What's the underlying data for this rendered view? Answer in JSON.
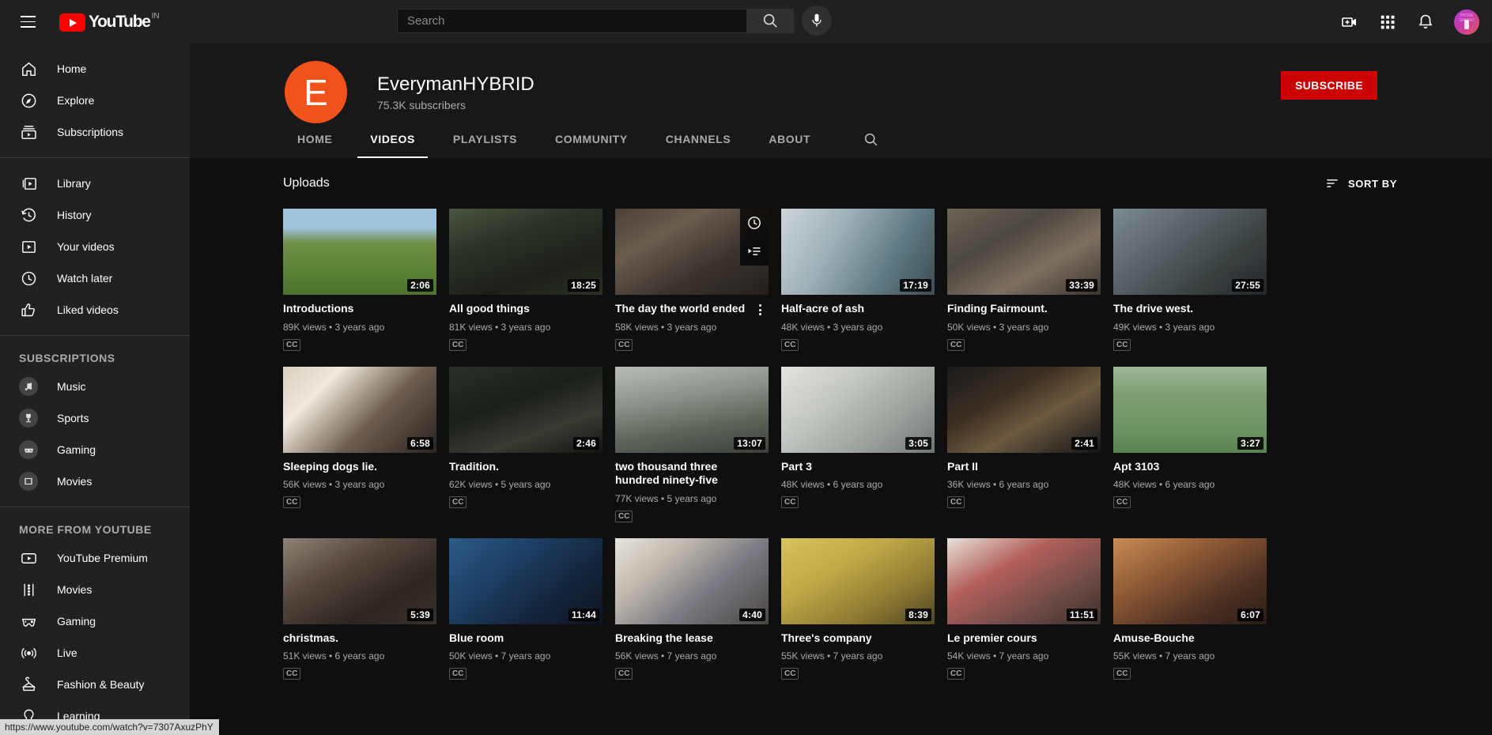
{
  "topbar": {
    "logo_text": "YouTube",
    "logo_country": "IN",
    "search_placeholder": "Search",
    "search_value": "",
    "icons": {
      "menu": "hamburger-icon",
      "search": "search-icon",
      "mic": "microphone-icon",
      "create": "create-video-icon",
      "apps": "youtube-apps-icon",
      "notifications": "notifications-bell-icon",
      "avatar": "account-avatar"
    }
  },
  "sidebar": {
    "primary": [
      {
        "label": "Home",
        "icon": "home-icon"
      },
      {
        "label": "Explore",
        "icon": "compass-icon"
      },
      {
        "label": "Subscriptions",
        "icon": "subscriptions-icon"
      }
    ],
    "library": [
      {
        "label": "Library",
        "icon": "library-icon"
      },
      {
        "label": "History",
        "icon": "history-icon"
      },
      {
        "label": "Your videos",
        "icon": "your-videos-icon"
      },
      {
        "label": "Watch later",
        "icon": "clock-icon"
      },
      {
        "label": "Liked videos",
        "icon": "thumbs-up-icon"
      }
    ],
    "subscriptions_title": "SUBSCRIPTIONS",
    "subscriptions": [
      {
        "label": "Music",
        "icon": "music-note-icon"
      },
      {
        "label": "Sports",
        "icon": "trophy-icon"
      },
      {
        "label": "Gaming",
        "icon": "gamepad-icon"
      },
      {
        "label": "Movies",
        "icon": "film-icon"
      }
    ],
    "more_title": "MORE FROM YOUTUBE",
    "more": [
      {
        "label": "YouTube Premium",
        "icon": "youtube-premium-icon"
      },
      {
        "label": "Movies",
        "icon": "film-strip-icon"
      },
      {
        "label": "Gaming",
        "icon": "gamepad-icon"
      },
      {
        "label": "Live",
        "icon": "live-broadcast-icon"
      },
      {
        "label": "Fashion & Beauty",
        "icon": "hanger-icon"
      },
      {
        "label": "Learning",
        "icon": "lightbulb-icon"
      }
    ]
  },
  "channel": {
    "avatar_letter": "E",
    "avatar_color": "#f1511b",
    "name": "EverymanHYBRID",
    "subscribers": "75.3K subscribers",
    "subscribe_label": "SUBSCRIBE",
    "subscribe_color": "#cc0000",
    "tabs": [
      {
        "label": "HOME",
        "active": false
      },
      {
        "label": "VIDEOS",
        "active": true
      },
      {
        "label": "PLAYLISTS",
        "active": false
      },
      {
        "label": "COMMUNITY",
        "active": false
      },
      {
        "label": "CHANNELS",
        "active": false
      },
      {
        "label": "ABOUT",
        "active": false
      }
    ]
  },
  "content": {
    "section_title": "Uploads",
    "sort_label": "SORT BY",
    "cc_badge": "CC",
    "rows": [
      [
        {
          "title": "Introductions",
          "duration": "2:06",
          "views": "89K views",
          "age": "3 years ago",
          "cc": true,
          "hovered": false,
          "thumb": "field-boy-running"
        },
        {
          "title": "All good things",
          "duration": "18:25",
          "views": "81K views",
          "age": "3 years ago",
          "cc": true,
          "hovered": false,
          "thumb": "two-men-outdoors"
        },
        {
          "title": "The day the world ended",
          "duration": "",
          "views": "58K views",
          "age": "3 years ago",
          "cc": true,
          "hovered": true,
          "thumb": "kitchen-fridge-men"
        },
        {
          "title": "Half-acre of ash",
          "duration": "17:19",
          "views": "48K views",
          "age": "3 years ago",
          "cc": true,
          "hovered": false,
          "thumb": "man-with-axe-door"
        },
        {
          "title": "Finding Fairmount.",
          "duration": "33:39",
          "views": "50K views",
          "age": "3 years ago",
          "cc": true,
          "hovered": false,
          "thumb": "burnt-debris"
        },
        {
          "title": "The drive west.",
          "duration": "27:55",
          "views": "49K views",
          "age": "3 years ago",
          "cc": true,
          "hovered": false,
          "thumb": "man-driving-car"
        }
      ],
      [
        {
          "title": "Sleeping dogs lie.",
          "duration": "6:58",
          "views": "56K views",
          "age": "3 years ago",
          "cc": true,
          "hovered": false,
          "thumb": "bedroom-window-light"
        },
        {
          "title": "Tradition.",
          "duration": "2:46",
          "views": "62K views",
          "age": "5 years ago",
          "cc": true,
          "hovered": false,
          "thumb": "man-christmas-tree"
        },
        {
          "title": "two thousand three hundred ninety-five",
          "duration": "13:07",
          "views": "77K views",
          "age": "5 years ago",
          "cc": true,
          "hovered": false,
          "thumb": "slow-down-sign-tree"
        },
        {
          "title": "Part 3",
          "duration": "3:05",
          "views": "48K views",
          "age": "6 years ago",
          "cc": true,
          "hovered": false,
          "thumb": "open-refrigerator"
        },
        {
          "title": "Part II",
          "duration": "2:41",
          "views": "36K views",
          "age": "6 years ago",
          "cc": true,
          "hovered": false,
          "thumb": "dark-room-person"
        },
        {
          "title": "Apt 3103",
          "duration": "3:27",
          "views": "48K views",
          "age": "6 years ago",
          "cc": true,
          "hovered": false,
          "thumb": "green-lawn-figure"
        }
      ],
      [
        {
          "title": "christmas.",
          "duration": "5:39",
          "views": "51K views",
          "age": "6 years ago",
          "cc": true,
          "hovered": false,
          "thumb": "two-men-laptop-couch"
        },
        {
          "title": "Blue room",
          "duration": "11:44",
          "views": "50K views",
          "age": "7 years ago",
          "cc": true,
          "hovered": false,
          "thumb": "blue-room-monitor"
        },
        {
          "title": "Breaking the lease",
          "duration": "4:40",
          "views": "56K views",
          "age": "7 years ago",
          "cc": true,
          "hovered": false,
          "thumb": "man-standing-doorway"
        },
        {
          "title": "Three's company",
          "duration": "8:39",
          "views": "55K views",
          "age": "7 years ago",
          "cc": true,
          "hovered": false,
          "thumb": "yellow-room-table"
        },
        {
          "title": "Le premier cours",
          "duration": "11:51",
          "views": "54K views",
          "age": "7 years ago",
          "cc": true,
          "hovered": false,
          "thumb": "plaid-shirt-man"
        },
        {
          "title": "Amuse-Bouche",
          "duration": "6:07",
          "views": "55K views",
          "age": "7 years ago",
          "cc": true,
          "hovered": false,
          "thumb": "warm-room-person"
        }
      ]
    ]
  },
  "statusbar": {
    "url": "https://www.youtube.com/watch?v=7307AxuzPhY"
  }
}
